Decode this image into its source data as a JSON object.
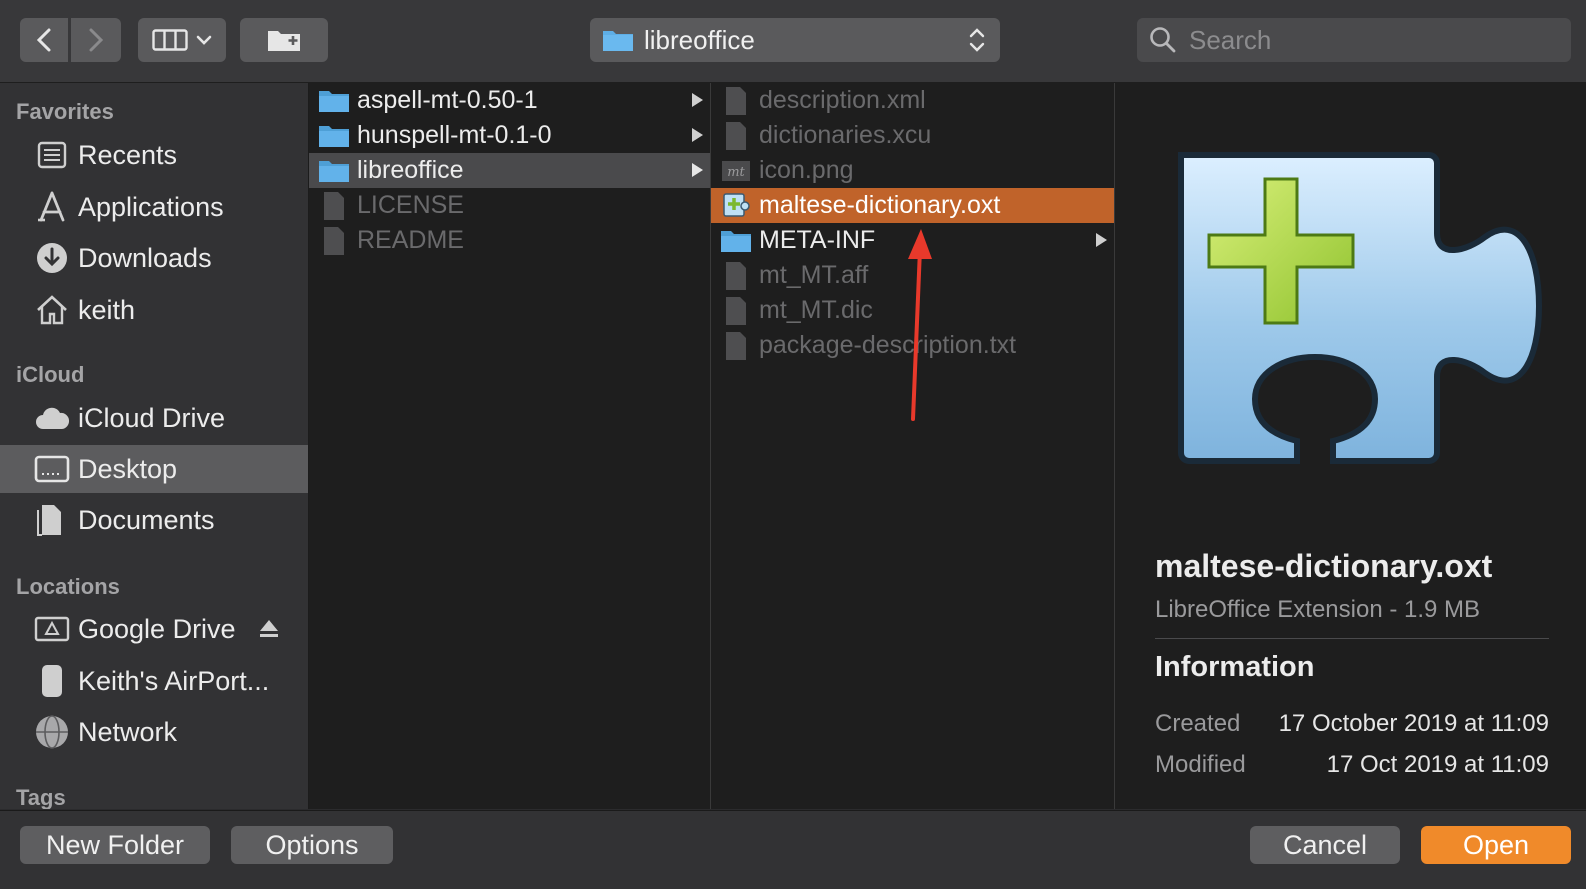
{
  "toolbar": {
    "location": "libreoffice",
    "search_placeholder": "Search"
  },
  "sidebar": {
    "sections": [
      {
        "title": "Favorites",
        "items": [
          {
            "label": "Recents",
            "icon": "recents-icon"
          },
          {
            "label": "Applications",
            "icon": "applications-icon"
          },
          {
            "label": "Downloads",
            "icon": "downloads-icon"
          },
          {
            "label": "keith",
            "icon": "home-icon"
          }
        ]
      },
      {
        "title": "iCloud",
        "items": [
          {
            "label": "iCloud Drive",
            "icon": "cloud-icon"
          },
          {
            "label": "Desktop",
            "icon": "desktop-icon",
            "selected": true
          },
          {
            "label": "Documents",
            "icon": "documents-icon"
          }
        ]
      },
      {
        "title": "Locations",
        "items": [
          {
            "label": "Google Drive",
            "icon": "drive-icon"
          },
          {
            "label": "Keith's AirPort...",
            "icon": "airport-icon"
          },
          {
            "label": "Network",
            "icon": "network-icon"
          }
        ]
      },
      {
        "title": "Tags",
        "items": []
      }
    ]
  },
  "columns": [
    {
      "items": [
        {
          "name": "aspell-mt-0.50-1",
          "kind": "folder"
        },
        {
          "name": "hunspell-mt-0.1-0",
          "kind": "folder"
        },
        {
          "name": "libreoffice",
          "kind": "folder",
          "selected": true
        },
        {
          "name": "LICENSE",
          "kind": "file"
        },
        {
          "name": "README",
          "kind": "file"
        }
      ]
    },
    {
      "items": [
        {
          "name": "description.xml",
          "kind": "file"
        },
        {
          "name": "dictionaries.xcu",
          "kind": "file"
        },
        {
          "name": "icon.png",
          "kind": "image",
          "badge": "mt"
        },
        {
          "name": "maltese-dictionary.oxt",
          "kind": "extension",
          "selected": true
        },
        {
          "name": "META-INF",
          "kind": "folder"
        },
        {
          "name": "mt_MT.aff",
          "kind": "file"
        },
        {
          "name": "mt_MT.dic",
          "kind": "file"
        },
        {
          "name": "package-description.txt",
          "kind": "file"
        }
      ]
    }
  ],
  "preview": {
    "name": "maltese-dictionary.oxt",
    "kind": "LibreOffice Extension - 1.9 MB",
    "section": "Information",
    "created_label": "Created",
    "created_value": "17 October 2019 at 11:09",
    "modified_label": "Modified",
    "modified_value": "17 Oct 2019 at 11:09"
  },
  "buttons": {
    "new_folder": "New Folder",
    "options": "Options",
    "cancel": "Cancel",
    "open": "Open"
  },
  "colors": {
    "selection_accent": "#c0632a",
    "primary_button": "#f08a2a",
    "annotation_arrow": "#e8392b"
  }
}
